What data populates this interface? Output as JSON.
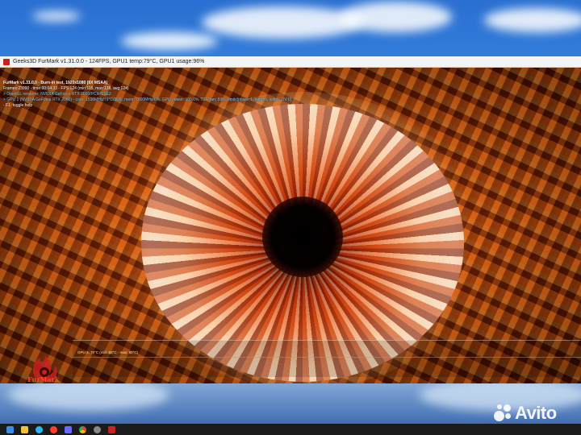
{
  "window": {
    "title": "Geeks3D FurMark v1.31.0.0 - 124FPS, GPU1 temp:79°C, GPU1 usage:96%"
  },
  "overlay": {
    "line1": "FurMark v1.31.0.0 - Burn-in test, 1920x1080 (8X MSAA)",
    "line2": "Frames:23990 - time:00:04:33 - FPS:124 (min:115, max:138, avg:124)",
    "line3": "> OpenGL renderer: NVIDIA GeForce RTX 2060/PCIe/SSE2",
    "line4": "> GPU 1 (NVIDIA GeForce RTX 2060) - core: 1530MHz/79°C/96%, mem: 7000MHz/6%, GPU power: 100.0% TDP, fan: 59%, limits[power:1, temp:0, volt:0, OV:0]",
    "line5": "- F1: toggle help"
  },
  "graph": {
    "label": "GPU 1: 79°C (min: 58°C - max: 80°C)"
  },
  "logo": {
    "text": "FurMark"
  },
  "taskbar": {
    "icons": [
      "windows-start-icon",
      "file-explorer-icon",
      "edge-icon",
      "yandex-icon",
      "store-icon",
      "chrome-icon",
      "settings-icon",
      "furmark-icon"
    ]
  },
  "watermark": {
    "text": "Avito"
  }
}
